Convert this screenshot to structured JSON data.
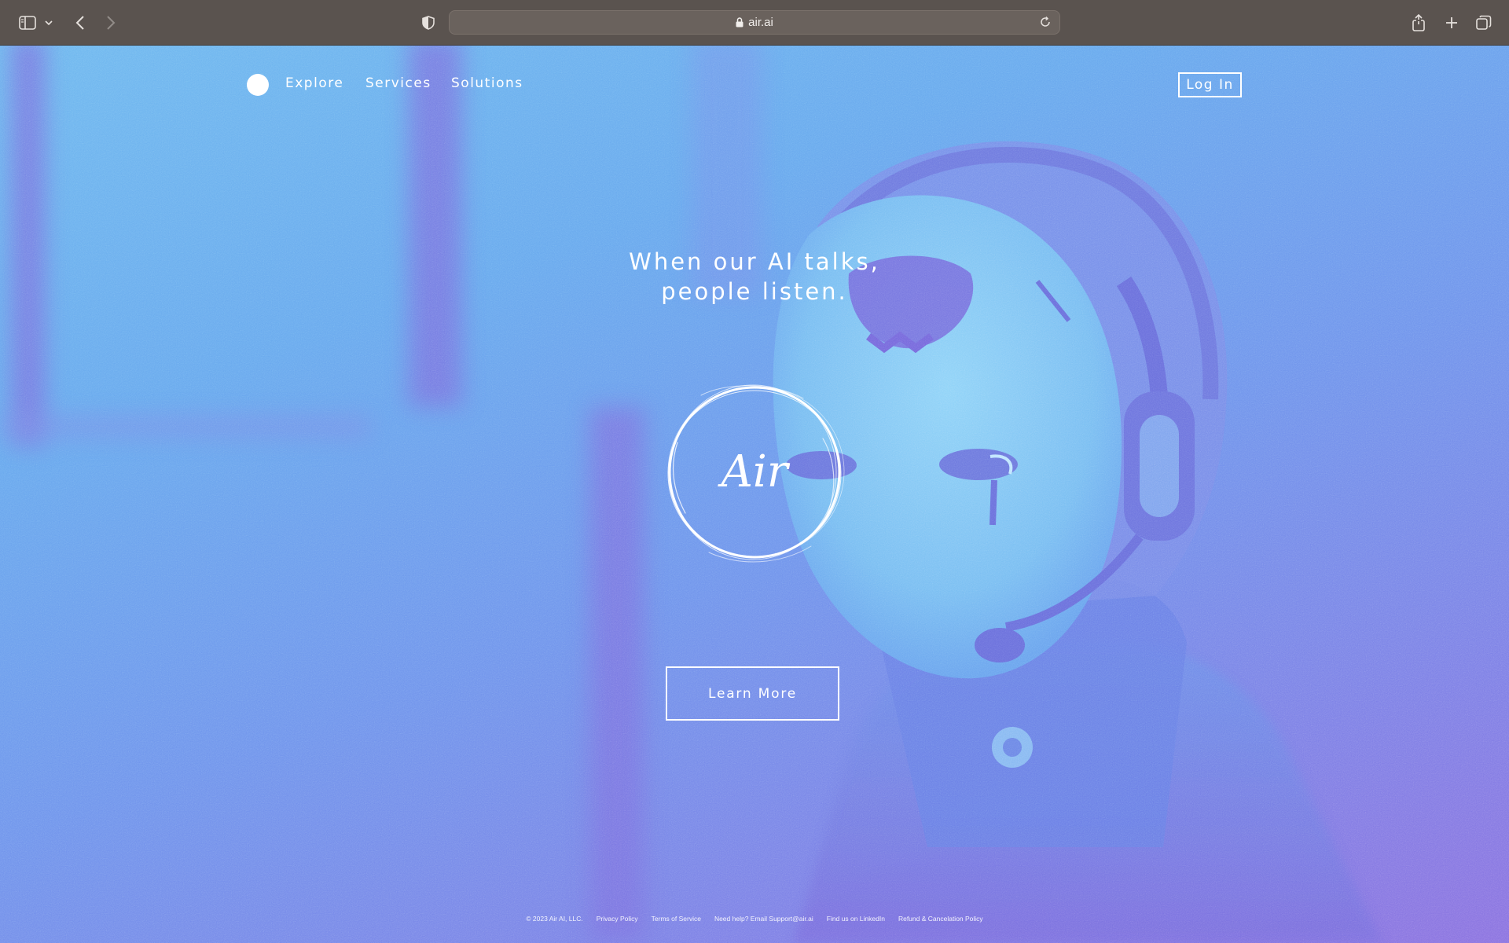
{
  "browser": {
    "url": "air.ai",
    "icons": {
      "sidebar": "sidebar-icon",
      "tab_dropdown": "chevron-down-icon",
      "back": "back-arrow-icon",
      "forward": "forward-arrow-icon",
      "privacy": "shield-icon",
      "secure": "lock-icon",
      "reload": "reload-icon",
      "share": "share-icon",
      "new_tab": "plus-icon",
      "tab_overview": "tabs-icon"
    }
  },
  "nav": {
    "items": [
      {
        "label": "Explore"
      },
      {
        "label": "Services"
      },
      {
        "label": "Solutions"
      }
    ],
    "login_label": "Log In"
  },
  "hero": {
    "headline_line1": "When our AI talks,",
    "headline_line2": "people listen.",
    "logo_text": "Air",
    "cta_label": "Learn More"
  },
  "footer": {
    "copyright": "© 2023 Air AI, LLC.",
    "links": [
      "Privacy Policy",
      "Terms of Service",
      "Need help? Email Support@air.ai",
      "Find us on LinkedIn",
      "Refund & Cancelation Policy"
    ]
  },
  "colors": {
    "chrome": "#5a534f",
    "accent_light": "#6fb8ef",
    "accent_dark": "#8a72e0",
    "text": "#ffffff"
  }
}
